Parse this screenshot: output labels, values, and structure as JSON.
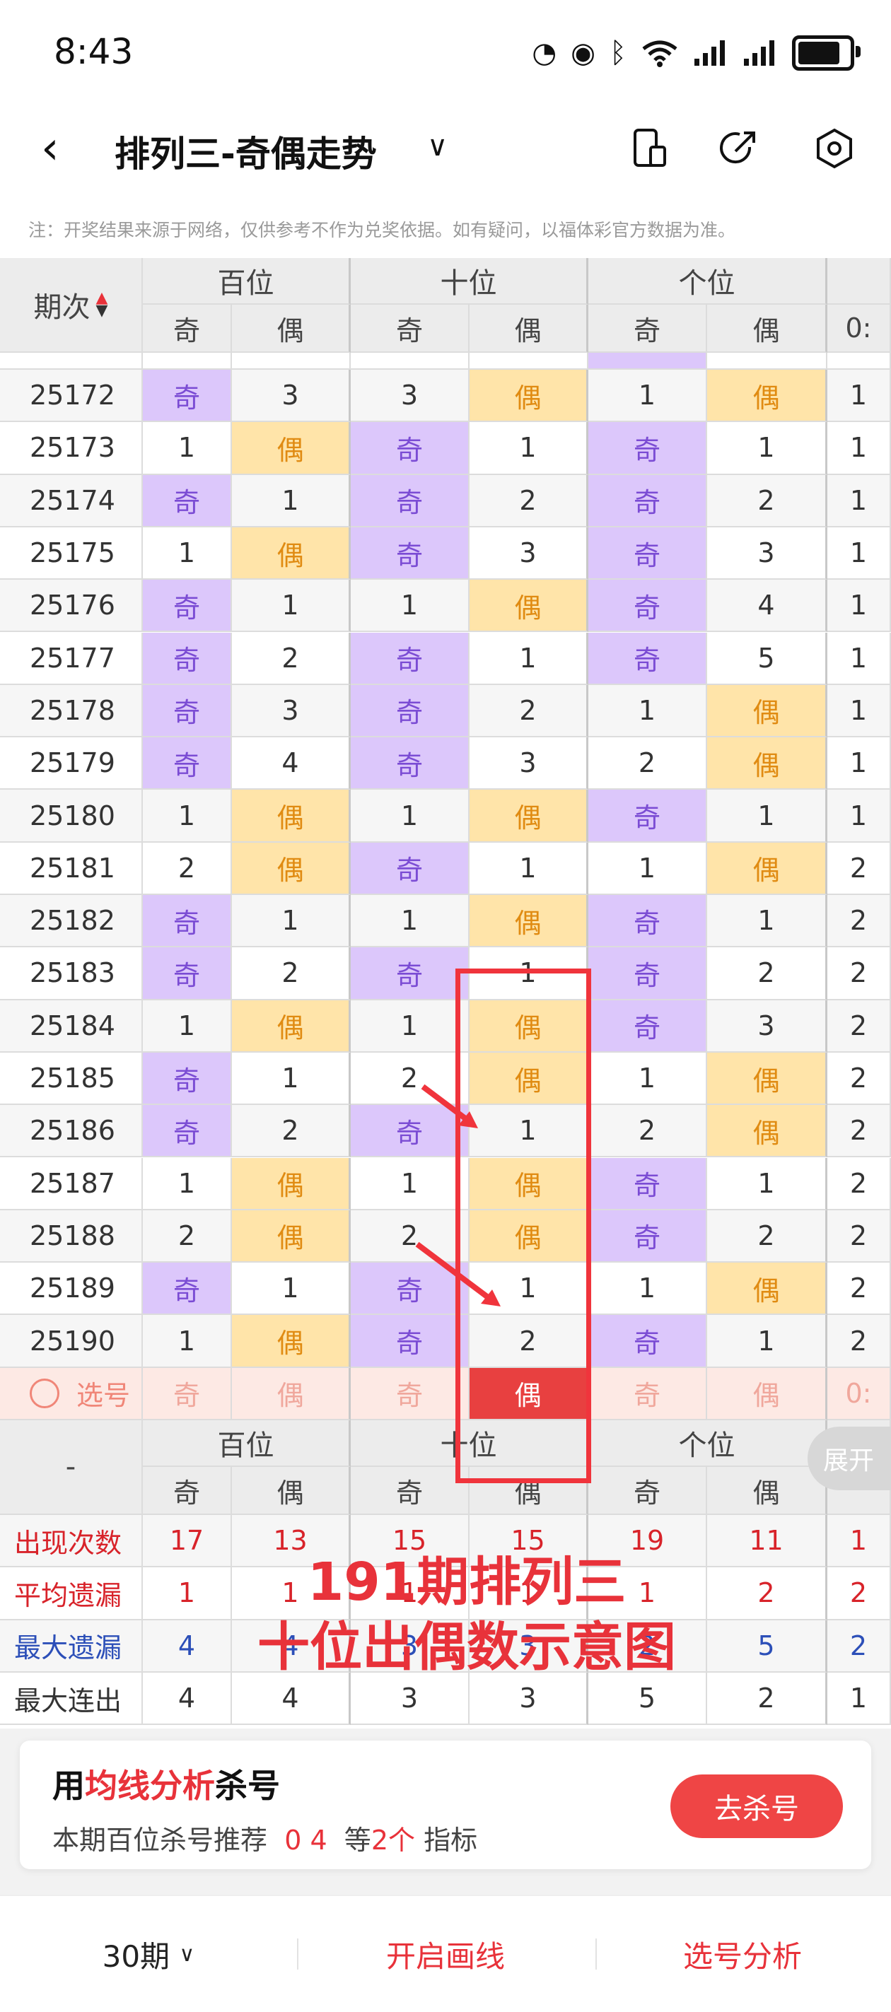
{
  "status": {
    "time": "8:43"
  },
  "nav": {
    "title": "排列三-奇偶走势"
  },
  "notice": "注：开奖结果来源于网络，仅供参考不作为兑奖依据。如有疑问，以福体彩官方数据为准。",
  "table": {
    "issue_header": "期次",
    "groups": [
      "百位",
      "十位",
      "个位"
    ],
    "odd_label": "奇",
    "even_label": "偶",
    "extra_header": "0:",
    "rows": [
      {
        "issue": "25172",
        "c": [
          "奇",
          "3",
          "3",
          "偶",
          "1",
          "偶"
        ],
        "x": "1"
      },
      {
        "issue": "25173",
        "c": [
          "1",
          "偶",
          "奇",
          "1",
          "奇",
          "1"
        ],
        "x": "1"
      },
      {
        "issue": "25174",
        "c": [
          "奇",
          "1",
          "奇",
          "2",
          "奇",
          "2"
        ],
        "x": "1"
      },
      {
        "issue": "25175",
        "c": [
          "1",
          "偶",
          "奇",
          "3",
          "奇",
          "3"
        ],
        "x": "1"
      },
      {
        "issue": "25176",
        "c": [
          "奇",
          "1",
          "1",
          "偶",
          "奇",
          "4"
        ],
        "x": "1"
      },
      {
        "issue": "25177",
        "c": [
          "奇",
          "2",
          "奇",
          "1",
          "奇",
          "5"
        ],
        "x": "1"
      },
      {
        "issue": "25178",
        "c": [
          "奇",
          "3",
          "奇",
          "2",
          "1",
          "偶"
        ],
        "x": "1"
      },
      {
        "issue": "25179",
        "c": [
          "奇",
          "4",
          "奇",
          "3",
          "2",
          "偶"
        ],
        "x": "1"
      },
      {
        "issue": "25180",
        "c": [
          "1",
          "偶",
          "1",
          "偶",
          "奇",
          "1"
        ],
        "x": "1"
      },
      {
        "issue": "25181",
        "c": [
          "2",
          "偶",
          "奇",
          "1",
          "1",
          "偶"
        ],
        "x": "2"
      },
      {
        "issue": "25182",
        "c": [
          "奇",
          "1",
          "1",
          "偶",
          "奇",
          "1"
        ],
        "x": "2"
      },
      {
        "issue": "25183",
        "c": [
          "奇",
          "2",
          "奇",
          "1",
          "奇",
          "2"
        ],
        "x": "2"
      },
      {
        "issue": "25184",
        "c": [
          "1",
          "偶",
          "1",
          "偶",
          "奇",
          "3"
        ],
        "x": "2"
      },
      {
        "issue": "25185",
        "c": [
          "奇",
          "1",
          "2",
          "偶",
          "1",
          "偶"
        ],
        "x": "2"
      },
      {
        "issue": "25186",
        "c": [
          "奇",
          "2",
          "奇",
          "1",
          "2",
          "偶"
        ],
        "x": "2"
      },
      {
        "issue": "25187",
        "c": [
          "1",
          "偶",
          "1",
          "偶",
          "奇",
          "1"
        ],
        "x": "2"
      },
      {
        "issue": "25188",
        "c": [
          "2",
          "偶",
          "2",
          "偶",
          "奇",
          "2"
        ],
        "x": "2"
      },
      {
        "issue": "25189",
        "c": [
          "奇",
          "1",
          "奇",
          "1",
          "1",
          "偶"
        ],
        "x": "2"
      },
      {
        "issue": "25190",
        "c": [
          "1",
          "偶",
          "奇",
          "2",
          "奇",
          "1"
        ],
        "x": "2"
      }
    ],
    "pick_row": {
      "label": "选号",
      "cells": [
        "奇",
        "偶",
        "奇",
        "偶",
        "奇",
        "偶"
      ],
      "selected_index": 3,
      "extra": "0:"
    },
    "stats": [
      {
        "label": "出现次数",
        "vals": [
          "17",
          "13",
          "15",
          "15",
          "19",
          "11"
        ],
        "x": "1",
        "tone": "red"
      },
      {
        "label": "平均遗漏",
        "vals": [
          "1",
          "1",
          "1",
          "1",
          "1",
          "2"
        ],
        "x": "2",
        "tone": "red"
      },
      {
        "label": "最大遗漏",
        "vals": [
          "4",
          "4",
          "3",
          "3",
          "2",
          "5"
        ],
        "x": "2",
        "tone": "blue"
      },
      {
        "label": "最大连出",
        "vals": [
          "4",
          "4",
          "3",
          "3",
          "5",
          "2"
        ],
        "x": "1",
        "tone": "dark"
      }
    ],
    "stat_header_dash": "-",
    "expand_label": "展开"
  },
  "overlay": {
    "line1": "191期排列三",
    "line2": "十位出偶数示意图"
  },
  "promo": {
    "title_prefix": "用",
    "title_highlight": "均线分析",
    "title_suffix": "杀号",
    "sub_prefix": "本期百位杀号推荐",
    "sub_nums": "0 4",
    "sub_mid1": "等",
    "sub_count": "2个",
    "sub_suffix": "指标",
    "button": "去杀号"
  },
  "bottom": {
    "period": "30期",
    "draw": "开启画线",
    "analysis": "选号分析"
  }
}
